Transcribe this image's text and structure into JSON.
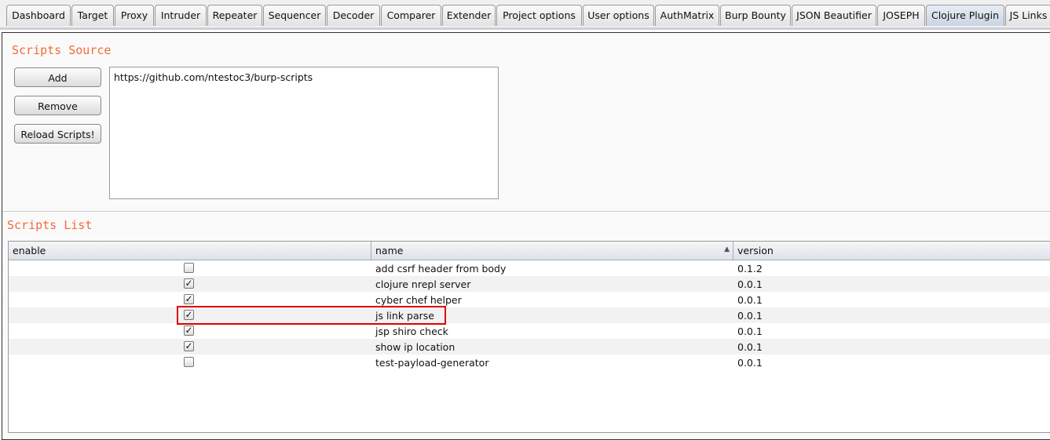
{
  "tabs": [
    {
      "label": "Dashboard"
    },
    {
      "label": "Target"
    },
    {
      "label": "Proxy"
    },
    {
      "label": "Intruder"
    },
    {
      "label": "Repeater"
    },
    {
      "label": "Sequencer"
    },
    {
      "label": "Decoder"
    },
    {
      "label": "Comparer"
    },
    {
      "label": "Extender"
    },
    {
      "label": "Project options"
    },
    {
      "label": "User options"
    },
    {
      "label": "AuthMatrix"
    },
    {
      "label": "Burp Bounty"
    },
    {
      "label": "JSON Beautifier"
    },
    {
      "label": "JOSEPH"
    },
    {
      "label": "Clojure Plugin",
      "selected": true
    },
    {
      "label": "JS Links"
    }
  ],
  "source": {
    "title": "Scripts Source",
    "add": "Add",
    "remove": "Remove",
    "reload": "Reload Scripts!",
    "entries": [
      "https://github.com/ntestoc3/burp-scripts"
    ]
  },
  "list": {
    "title": "Scripts List",
    "columns": [
      "enable",
      "name",
      "version"
    ],
    "sort_column": "name",
    "sort_icon": "sort-ascending-icon",
    "rows": [
      {
        "enable": false,
        "name": "add csrf header from body",
        "version": "0.1.2"
      },
      {
        "enable": true,
        "name": "clojure nrepl server",
        "version": "0.0.1"
      },
      {
        "enable": true,
        "name": "cyber chef helper",
        "version": "0.0.1"
      },
      {
        "enable": true,
        "name": "js link parse",
        "version": "0.0.1",
        "highlighted": true
      },
      {
        "enable": true,
        "name": "jsp shiro check",
        "version": "0.0.1"
      },
      {
        "enable": true,
        "name": "show ip location",
        "version": "0.0.1"
      },
      {
        "enable": false,
        "name": "test-payload-generator",
        "version": "0.0.1"
      }
    ]
  },
  "colors": {
    "heading": "#f36b3a",
    "highlight": "#e00000"
  }
}
